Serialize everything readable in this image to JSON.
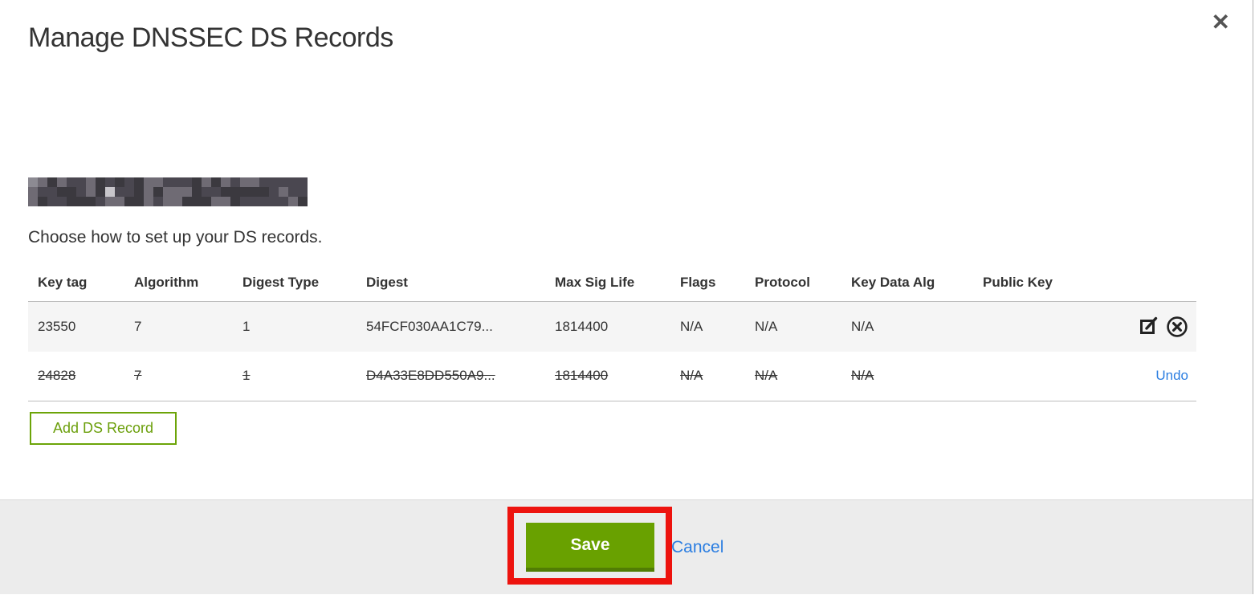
{
  "modal": {
    "title": "Manage DNSSEC DS Records",
    "close_icon": "✕",
    "instruction": "Choose how to set up your DS records."
  },
  "table": {
    "columns": [
      "Key tag",
      "Algorithm",
      "Digest Type",
      "Digest",
      "Max Sig Life",
      "Flags",
      "Protocol",
      "Key Data Alg",
      "Public Key"
    ],
    "rows": [
      {
        "key_tag": "23550",
        "algorithm": "7",
        "digest_type": "1",
        "digest": "54FCF030AA1C79...",
        "max_sig_life": "1814400",
        "flags": "N/A",
        "protocol": "N/A",
        "key_data_alg": "N/A",
        "public_key": "",
        "state": "current",
        "action_icons": [
          "edit-icon",
          "delete-icon"
        ]
      },
      {
        "key_tag": "24828",
        "algorithm": "7",
        "digest_type": "1",
        "digest": "D4A33E8DD550A9...",
        "max_sig_life": "1814400",
        "flags": "N/A",
        "protocol": "N/A",
        "key_data_alg": "N/A",
        "public_key": "",
        "state": "deleted",
        "action_label": "Undo"
      }
    ]
  },
  "buttons": {
    "add_ds_record": "Add DS Record",
    "save": "Save",
    "cancel": "Cancel"
  },
  "colors": {
    "button_green": "#69a100",
    "button_green_shadow": "#517d04",
    "outline_green": "#6ca408",
    "link_blue": "#2a7de1",
    "annotation_red": "#ed130e",
    "row_stripe": "#f5f5f5",
    "footer_gray": "#ececec"
  }
}
